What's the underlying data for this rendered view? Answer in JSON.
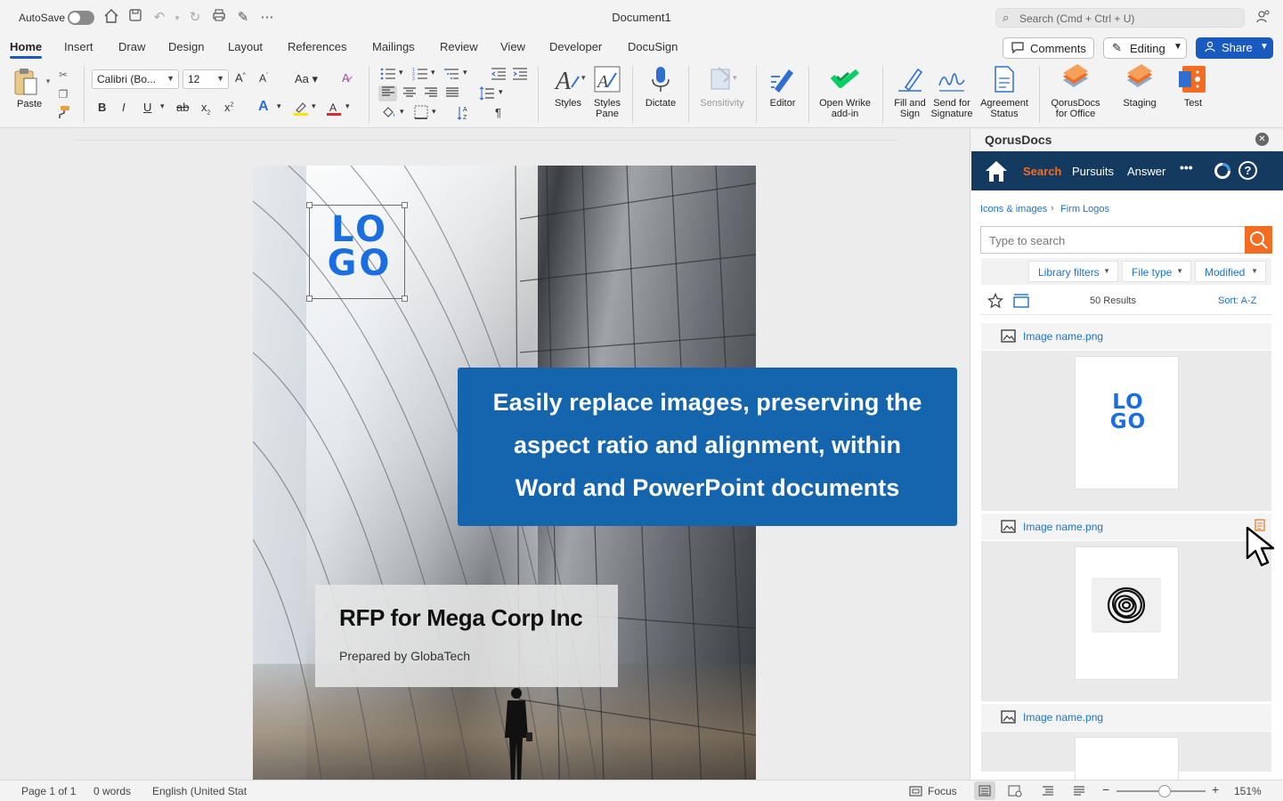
{
  "titlebar": {
    "autosave_label": "AutoSave",
    "doc_title": "Document1",
    "search_placeholder": "Search (Cmd + Ctrl + U)"
  },
  "tabs": [
    "Home",
    "Insert",
    "Draw",
    "Design",
    "Layout",
    "References",
    "Mailings",
    "Review",
    "View",
    "Developer",
    "DocuSign"
  ],
  "actions": {
    "comments": "Comments",
    "editing": "Editing",
    "share": "Share"
  },
  "ribbon": {
    "paste": "Paste",
    "font_name": "Calibri (Bo...",
    "font_size": "12",
    "buttons": {
      "styles": "Styles",
      "styles_pane_1": "Styles",
      "styles_pane_2": "Pane",
      "dictate": "Dictate",
      "sensitivity": "Sensitivity",
      "editor": "Editor",
      "wrike_1": "Open Wrike",
      "wrike_2": "add-in",
      "fill_1": "Fill and",
      "fill_2": "Sign",
      "send_1": "Send for",
      "send_2": "Signature",
      "agree_1": "Agreement",
      "agree_2": "Status",
      "qorus_1": "QorusDocs",
      "qorus_2": "for Office",
      "staging": "Staging",
      "test": "Test"
    }
  },
  "document": {
    "logo_line1": "LO",
    "logo_line2": "GO",
    "rfp_title": "RFP for Mega Corp Inc",
    "rfp_subtitle": "Prepared by GlobaTech"
  },
  "callout": {
    "line1": "Easily replace images, preserving the",
    "line2": "aspect ratio and alignment, within",
    "line3": "Word and PowerPoint documents"
  },
  "statusbar": {
    "page": "Page 1 of 1",
    "words": "0 words",
    "language": "English (United Stat",
    "focus": "Focus",
    "zoom": "151%"
  },
  "panel": {
    "title": "QorusDocs",
    "nav": [
      "Search",
      "Pursuits",
      "Answer"
    ],
    "breadcrumb": [
      "Icons & images",
      "Firm Logos"
    ],
    "search_placeholder": "Type to search",
    "filters": [
      "Library filters",
      "File type",
      "Modified"
    ],
    "results": "50 Results",
    "sort": "Sort: A-Z",
    "items": [
      "Image name.png",
      "Image name.png",
      "Image name.png"
    ]
  },
  "colors": {
    "accent": "#185abd",
    "qorus_nav": "#153a5f",
    "qorus_orange": "#f26c21",
    "callout": "#1465ae",
    "logo_blue": "#1a6ee0"
  }
}
